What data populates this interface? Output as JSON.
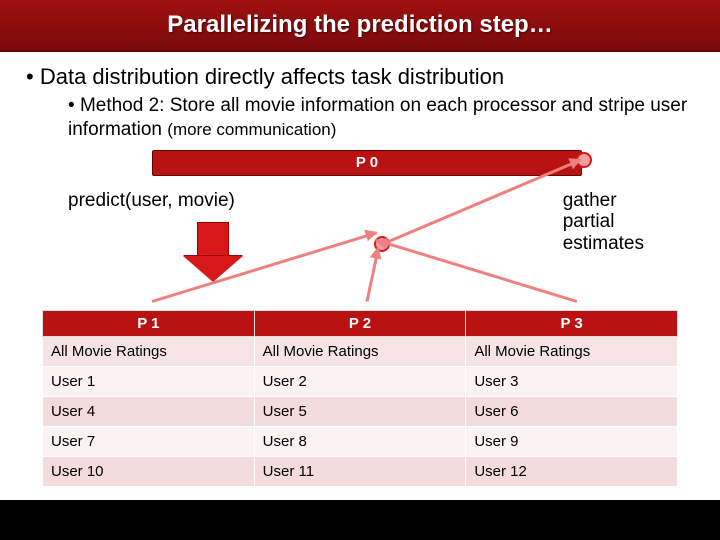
{
  "title": "Parallelizing the prediction step…",
  "bullet1": "Data distribution directly affects task distribution",
  "bullet2_a": "Method 2: Store all movie information on each processor and stripe user information ",
  "bullet2_b": "(more communication)",
  "p0_label": "P 0",
  "predict_label": "predict(user, movie)",
  "gather_label": "gather\npartial\nestimates",
  "columns": {
    "p1": "P 1",
    "p2": "P 2",
    "p3": "P 3"
  },
  "rows": [
    {
      "c1": "All Movie Ratings",
      "c2": "All Movie Ratings",
      "c3": "All Movie Ratings"
    },
    {
      "c1": "User 1",
      "c2": "User 2",
      "c3": "User 3"
    },
    {
      "c1": "User 4",
      "c2": "User 5",
      "c3": "User 6"
    },
    {
      "c1": "User 7",
      "c2": "User 8",
      "c3": "User 9"
    },
    {
      "c1": "User 10",
      "c2": "User 11",
      "c3": "User 12"
    }
  ]
}
